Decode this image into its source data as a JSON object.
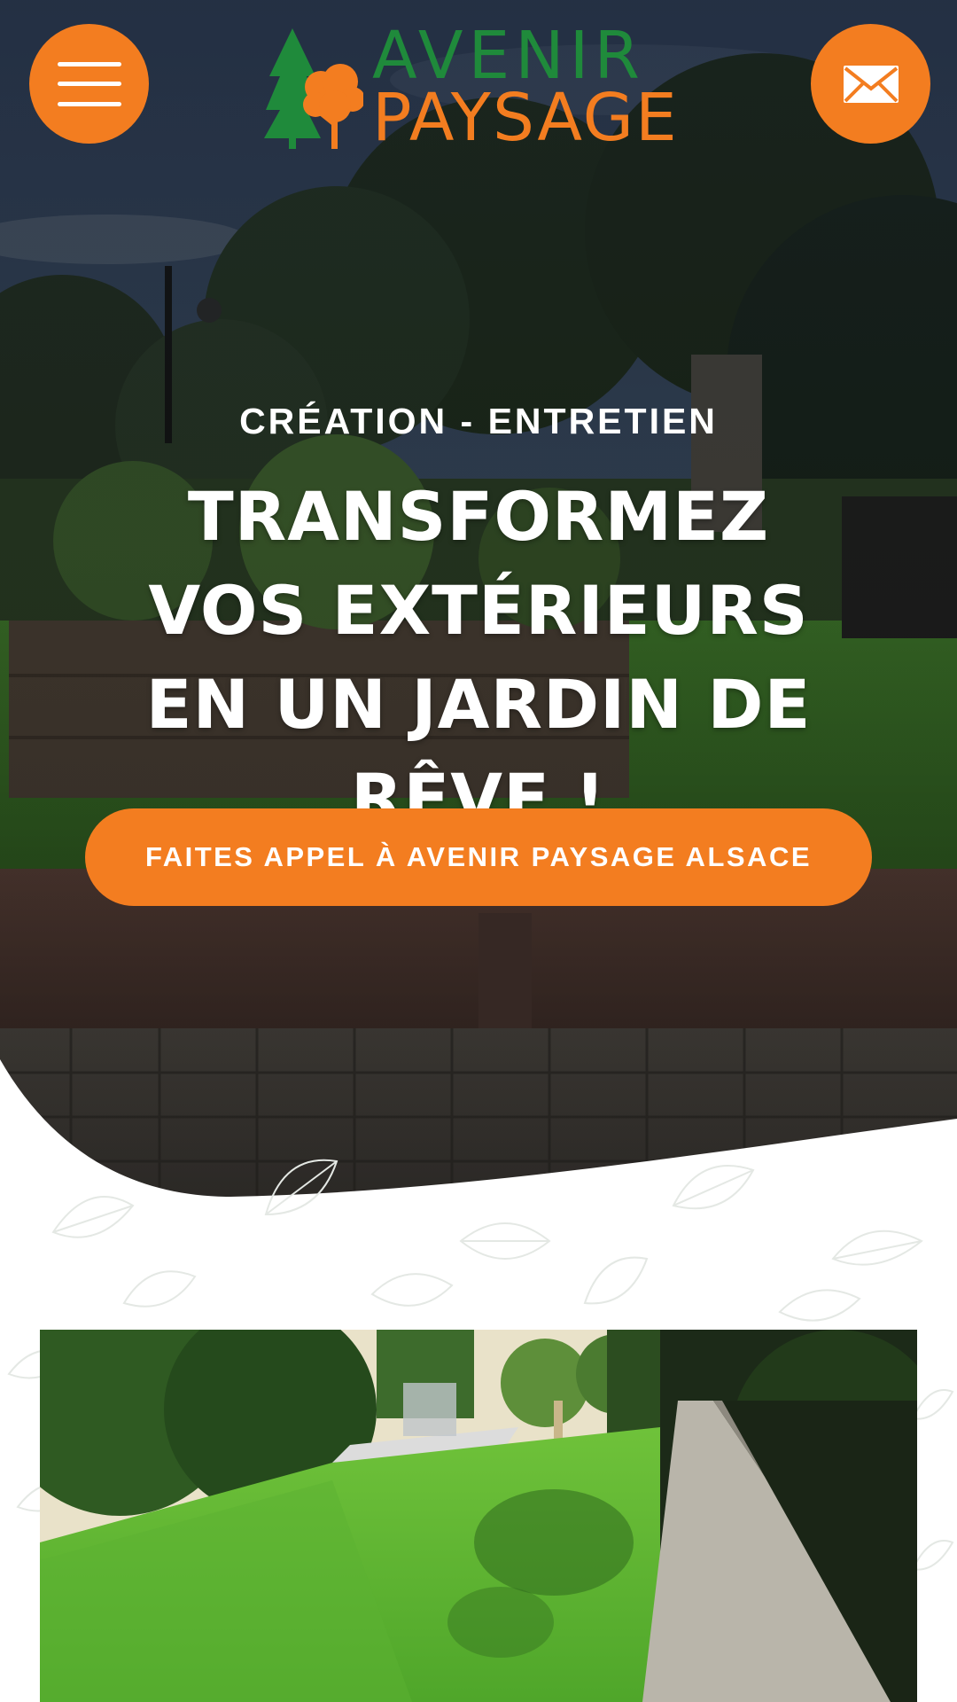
{
  "header": {
    "menu_icon": "hamburger-menu-icon",
    "contact_icon": "envelope-icon",
    "logo": {
      "line1": "AVENIR",
      "line2": "PAYSAGE",
      "icon": "trees-icon"
    }
  },
  "hero": {
    "kicker": "CRÉATION - ENTRETIEN",
    "headline": "TRANSFORMEZ VOS EXTÉRIEURS EN UN JARDIN DE RÊVE !",
    "cta_label": "FAITES APPEL À AVENIR PAYSAGE ALSACE"
  },
  "colors": {
    "accent_orange": "#f37d20",
    "brand_green": "#1f8a3b",
    "background": "#ffffff"
  }
}
